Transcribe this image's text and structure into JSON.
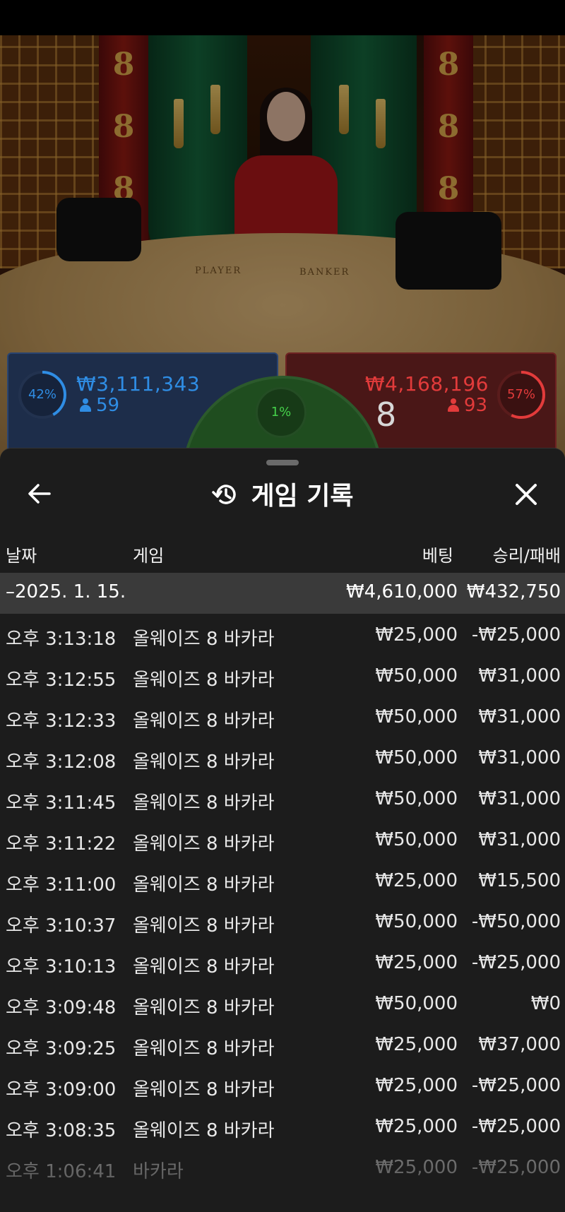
{
  "table": {
    "player_label": "PLAYER",
    "banker_label": "BANKER"
  },
  "betting": {
    "player": {
      "percent_label": "42%",
      "percent": 42,
      "amount": "₩3,111,343",
      "players": "59",
      "color": "#2f8de4"
    },
    "tie": {
      "percent_label": "1%",
      "percent": 1,
      "color": "#45d14a"
    },
    "banker": {
      "percent_label": "57%",
      "percent": 57,
      "amount": "₩4,168,196",
      "players": "93",
      "score": "8",
      "color": "#e23b3b"
    }
  },
  "sheet": {
    "title": "게임 기록",
    "back_icon": "arrow-left-icon",
    "history_icon": "history-icon",
    "close_icon": "close-icon",
    "columns": {
      "date": "날짜",
      "game": "게임",
      "bet": "베팅",
      "win_loss": "승리/패배"
    },
    "date_group": {
      "date": "–2025. 1. 15.",
      "bet_total": "₩4,610,000",
      "win_total": "₩432,750"
    },
    "rows": [
      {
        "time": "오후 3:13:18",
        "game": "올웨이즈 8 바카라",
        "bet": "₩25,000",
        "result": "-₩25,000"
      },
      {
        "time": "오후 3:12:55",
        "game": "올웨이즈 8 바카라",
        "bet": "₩50,000",
        "result": "₩31,000"
      },
      {
        "time": "오후 3:12:33",
        "game": "올웨이즈 8 바카라",
        "bet": "₩50,000",
        "result": "₩31,000"
      },
      {
        "time": "오후 3:12:08",
        "game": "올웨이즈 8 바카라",
        "bet": "₩50,000",
        "result": "₩31,000"
      },
      {
        "time": "오후 3:11:45",
        "game": "올웨이즈 8 바카라",
        "bet": "₩50,000",
        "result": "₩31,000"
      },
      {
        "time": "오후 3:11:22",
        "game": "올웨이즈 8 바카라",
        "bet": "₩50,000",
        "result": "₩31,000"
      },
      {
        "time": "오후 3:11:00",
        "game": "올웨이즈 8 바카라",
        "bet": "₩25,000",
        "result": "₩15,500"
      },
      {
        "time": "오후 3:10:37",
        "game": "올웨이즈 8 바카라",
        "bet": "₩50,000",
        "result": "-₩50,000"
      },
      {
        "time": "오후 3:10:13",
        "game": "올웨이즈 8 바카라",
        "bet": "₩25,000",
        "result": "-₩25,000"
      },
      {
        "time": "오후 3:09:48",
        "game": "올웨이즈 8 바카라",
        "bet": "₩50,000",
        "result": "₩0"
      },
      {
        "time": "오후 3:09:25",
        "game": "올웨이즈 8 바카라",
        "bet": "₩25,000",
        "result": "₩37,000"
      },
      {
        "time": "오후 3:09:00",
        "game": "올웨이즈 8 바카라",
        "bet": "₩25,000",
        "result": "-₩25,000"
      },
      {
        "time": "오후 3:08:35",
        "game": "올웨이즈 8 바카라",
        "bet": "₩25,000",
        "result": "-₩25,000"
      },
      {
        "time": "오후 1:06:41",
        "game": "바카라",
        "bet": "₩25,000",
        "result": "-₩25,000"
      }
    ]
  }
}
